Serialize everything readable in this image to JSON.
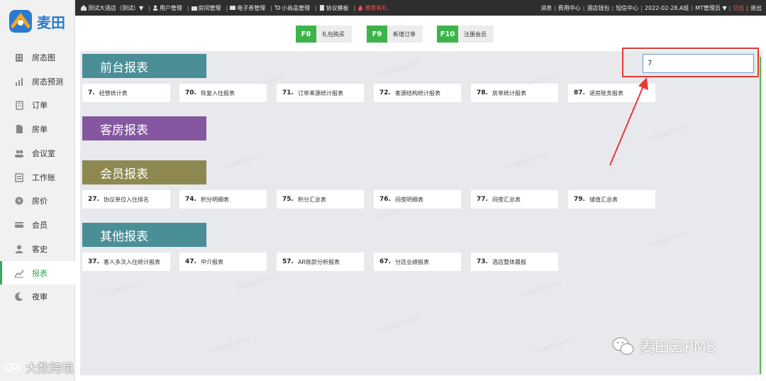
{
  "brand": {
    "name": "麦田"
  },
  "sidebar": {
    "items": [
      {
        "label": "房态图",
        "icon": "building-icon"
      },
      {
        "label": "房态预测",
        "icon": "chart-icon"
      },
      {
        "label": "订单",
        "icon": "order-icon"
      },
      {
        "label": "房单",
        "icon": "document-icon"
      },
      {
        "label": "会议室",
        "icon": "meeting-icon"
      },
      {
        "label": "工作账",
        "icon": "ledger-icon"
      },
      {
        "label": "房价",
        "icon": "price-icon"
      },
      {
        "label": "会员",
        "icon": "card-icon"
      },
      {
        "label": "客史",
        "icon": "person-icon"
      },
      {
        "label": "报表",
        "icon": "report-icon",
        "active": true
      },
      {
        "label": "夜审",
        "icon": "moon-icon"
      }
    ]
  },
  "topbar": {
    "hotel": "测试大酒店（测试）▼",
    "links": [
      "用户管理",
      "房间管理",
      "电子券管理",
      "小商品管理",
      "协议模板"
    ],
    "promo": "推荐有礼",
    "right": [
      "消息",
      "费用中心",
      "酒店钱包",
      "短信中心",
      "2022-02-28.A班",
      "MT管理员 ▼"
    ],
    "shift": "交班",
    "logout": "退出"
  },
  "shortcuts": [
    {
      "key": "F8",
      "label": "礼包购买"
    },
    {
      "key": "F9",
      "label": "新增订单"
    },
    {
      "key": "F10",
      "label": "注册会员"
    }
  ],
  "search": {
    "value": "7"
  },
  "sections": [
    {
      "title": "前台报表",
      "color": "#4a8e96",
      "reports": [
        {
          "num": "7.",
          "label": "经营统计表"
        },
        {
          "num": "70.",
          "label": "恢复入住报表"
        },
        {
          "num": "71.",
          "label": "订单来源统计报表"
        },
        {
          "num": "72.",
          "label": "客源结构统计报表"
        },
        {
          "num": "78.",
          "label": "房单统计报表"
        },
        {
          "num": "87.",
          "label": "退房账务报表"
        }
      ]
    },
    {
      "title": "客房报表",
      "color": "#8457a0",
      "reports": []
    },
    {
      "title": "会员报表",
      "color": "#8d8850",
      "reports": [
        {
          "num": "27.",
          "label": "协议单位入住排名"
        },
        {
          "num": "74.",
          "label": "积分明细表"
        },
        {
          "num": "75.",
          "label": "积分汇总表"
        },
        {
          "num": "76.",
          "label": "间夜明细表"
        },
        {
          "num": "77.",
          "label": "间夜汇总表"
        },
        {
          "num": "79.",
          "label": "储值汇总表"
        }
      ]
    },
    {
      "title": "其他报表",
      "color": "#4a8e96",
      "reports": [
        {
          "num": "37.",
          "label": "客人多次入住统计报表"
        },
        {
          "num": "47.",
          "label": "中介报表"
        },
        {
          "num": "57.",
          "label": "AR账龄分析报表"
        },
        {
          "num": "67.",
          "label": "分店业绩报表"
        },
        {
          "num": "73.",
          "label": "酒店整体晨报"
        }
      ]
    }
  ],
  "watermarks": {
    "brand": "麦田云PMS",
    "corner": "大数跨境"
  },
  "colors": {
    "accent": "#3cb44b",
    "highlight": "#e53935",
    "topbar": "#2e2e2e"
  }
}
